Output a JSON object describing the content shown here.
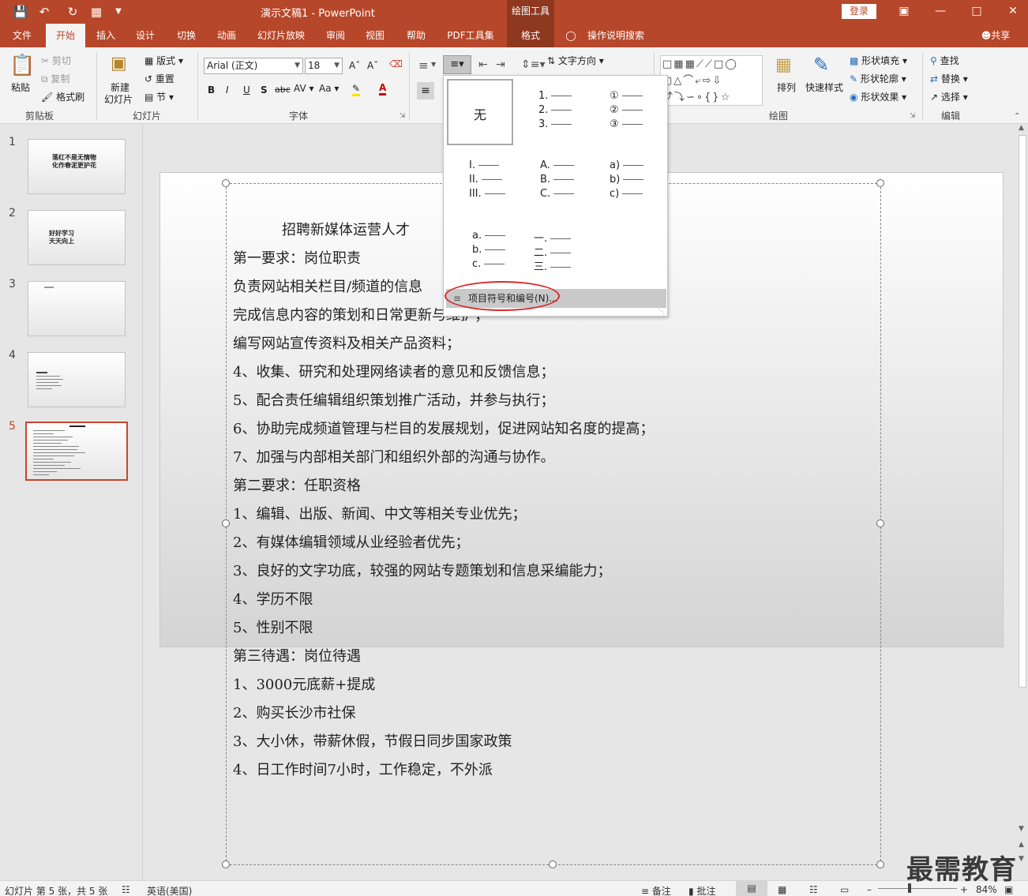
{
  "titlebar": {
    "title": "演示文稿1 - PowerPoint",
    "context_tools": "绘图工具",
    "login": "登录"
  },
  "tabs": [
    "文件",
    "开始",
    "插入",
    "设计",
    "切换",
    "动画",
    "幻灯片放映",
    "审阅",
    "视图",
    "帮助",
    "PDF工具集",
    "格式"
  ],
  "tell_me": "操作说明搜索",
  "share": "共享",
  "ribbon": {
    "paste": "粘贴",
    "cut": "剪切",
    "copy": "复制",
    "format_painter": "格式刷",
    "clipboard": "剪贴板",
    "new_slide": "新建",
    "new_slide2": "幻灯片",
    "layout": "版式",
    "reset": "重置",
    "section": "节",
    "slides": "幻灯片",
    "font_name": "Arial (正文)",
    "font_size": "18",
    "font": "字体",
    "text_direction": "文字方向",
    "arrange": "排列",
    "quick_styles": "快速样式",
    "shape_fill": "形状填充",
    "shape_outline": "形状轮廓",
    "shape_effects": "形状效果",
    "drawing": "绘图",
    "find": "查找",
    "replace": "替换",
    "select": "选择",
    "editing": "编辑"
  },
  "gallery": {
    "none": "无",
    "c1": [
      "1.",
      "2.",
      "3."
    ],
    "c2": [
      "①",
      "②",
      "③"
    ],
    "c3": [
      "I.",
      "II.",
      "III."
    ],
    "c4": [
      "A.",
      "B.",
      "C."
    ],
    "c5": [
      "a)",
      "b)",
      "c)"
    ],
    "c6": [
      "a.",
      "b.",
      "c."
    ],
    "c7": [
      "一.",
      "二.",
      "三."
    ],
    "menu": "项目符号和编号(N)..."
  },
  "thumbs": {
    "nums": [
      "1",
      "2",
      "3",
      "4",
      "5"
    ],
    "t1": [
      "落红不是无情物",
      "化作春泥更护花"
    ],
    "t2": [
      "好好学习",
      "天天向上"
    ]
  },
  "slide_lines": [
    "招聘新媒体运营人才",
    "第一要求：岗位职责",
    "负责网站相关栏目/频道的信息",
    "完成信息内容的策划和日常更新与维护；",
    "编写网站宣传资料及相关产品资料；",
    "4、收集、研究和处理网络读者的意见和反馈信息；",
    "5、配合责任编辑组织策划推广活动，并参与执行；",
    "6、协助完成频道管理与栏目的发展规划，促进网站知名度的提高；",
    "7、加强与内部相关部门和组织外部的沟通与协作。",
    "第二要求：任职资格",
    "1、编辑、出版、新闻、中文等相关专业优先；",
    "2、有媒体编辑领域从业经验者优先；",
    "3、良好的文字功底，较强的网站专题策划和信息采编能力；",
    "4、学历不限",
    "5、性别不限",
    "第三待遇：岗位待遇",
    "1、3000元底薪+提成",
    "2、购买长沙市社保",
    "3、大小休，带薪休假，节假日同步国家政策",
    "4、日工作时间7小时，工作稳定，不外派"
  ],
  "status": {
    "slide_info": "幻灯片 第 5 张，共 5 张",
    "language": "英语(美国)",
    "notes": "备注",
    "comments": "批注",
    "zoom": "84%"
  },
  "watermark": "最需教育"
}
